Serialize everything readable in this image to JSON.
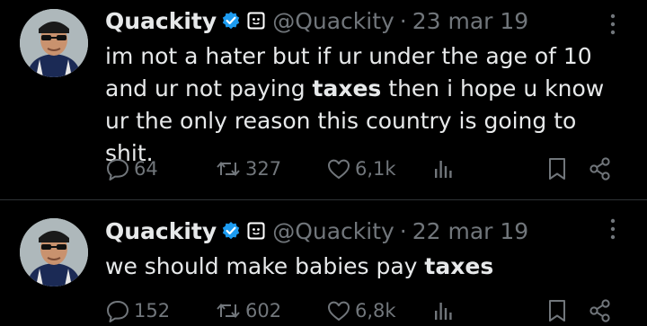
{
  "tweets": [
    {
      "name": "Quackity",
      "handle": "@Quackity",
      "separator": "·",
      "date": "23 mar 19",
      "text_parts": [
        "im not a hater but if ur under the age of 10 and ur not paying ",
        "taxes",
        " then i hope u know ur the only reason this country is going to shit."
      ],
      "replies": "64",
      "retweets": "327",
      "likes": "6,1k"
    },
    {
      "name": "Quackity",
      "handle": "@Quackity",
      "separator": "·",
      "date": "22 mar 19",
      "text_parts": [
        "we should make babies pay ",
        "taxes",
        ""
      ],
      "replies": "152",
      "retweets": "602",
      "likes": "6,8k"
    }
  ],
  "icons": {
    "verified": "verified-badge-icon",
    "affiliate": "affiliate-badge-icon",
    "more": "more-options-icon",
    "reply": "reply-icon",
    "retweet": "retweet-icon",
    "like": "heart-icon",
    "views": "views-icon",
    "bookmark": "bookmark-icon",
    "share": "share-icon"
  },
  "colors": {
    "background": "#000000",
    "text": "#e7e9ea",
    "secondary": "#71767b",
    "verified": "#1d9bf0",
    "divider": "#2f3336"
  }
}
